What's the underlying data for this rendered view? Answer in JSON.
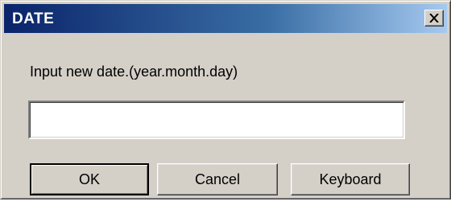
{
  "dialog": {
    "title": "DATE",
    "close_glyph": "X",
    "prompt": "Input new date.(year.month.day)",
    "date_value": "",
    "buttons": {
      "ok_label": "OK",
      "cancel_label": "Cancel",
      "keyboard_label": "Keyboard"
    }
  },
  "colors": {
    "titlebar_start": "#0a246a",
    "titlebar_end": "#a6caf0",
    "face": "#d4d0c8"
  },
  "icons": {
    "close": "close-icon"
  }
}
